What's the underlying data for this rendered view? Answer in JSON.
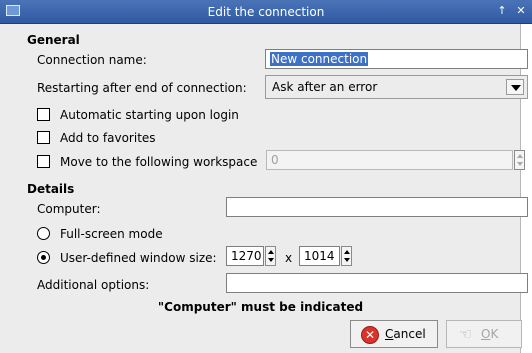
{
  "title_bar": {
    "title": "Edit the connection",
    "pin_glyph": "↑",
    "close_glyph": "✕"
  },
  "general": {
    "heading": "General",
    "connection_name_label": "Connection name:",
    "connection_name_value": "New connection",
    "restart_label": "Restarting after end of connection:",
    "restart_value": "Ask after an error",
    "auto_start_label": "Automatic starting upon login",
    "favorites_label": "Add to favorites",
    "workspace_label": "Move to the following workspace",
    "workspace_value": "0"
  },
  "details": {
    "heading": "Details",
    "computer_label": "Computer:",
    "computer_value": "",
    "fullscreen_label": "Full-screen mode",
    "custom_size_label": "User-defined window size:",
    "width_value": "1270",
    "times_sign": "x",
    "height_value": "1014",
    "additional_label": "Additional options:",
    "additional_value": ""
  },
  "warning": "\"Computer\" must be indicated",
  "buttons": {
    "cancel_first": "C",
    "cancel_rest": "ancel",
    "ok_first": "O",
    "ok_rest": "K"
  }
}
